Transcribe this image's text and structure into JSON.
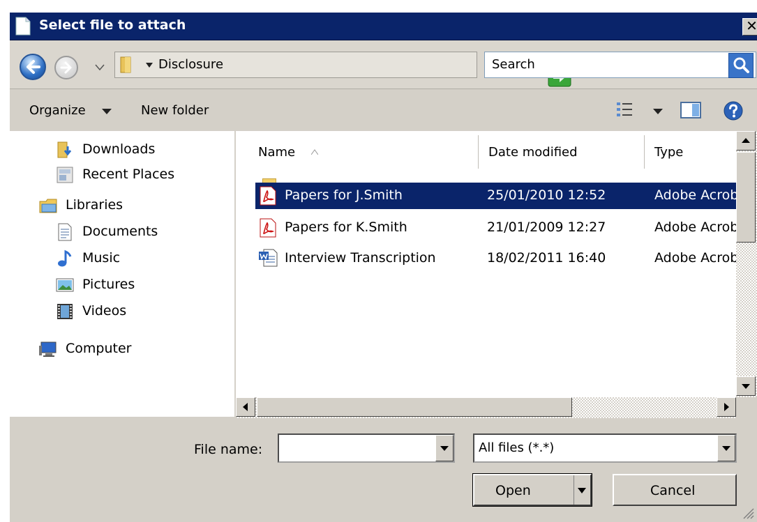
{
  "window": {
    "title": "Select file to attach",
    "close_glyph": "✕"
  },
  "address": {
    "current_folder": "Disclosure",
    "search_placeholder": "Search"
  },
  "toolbar": {
    "organize_label": "Organize",
    "new_folder_label": "New folder"
  },
  "nav_pane": {
    "items": [
      {
        "label": "Downloads",
        "icon": "downloads-folder-icon"
      },
      {
        "label": "Recent Places",
        "icon": "recent-places-icon"
      },
      {
        "label": "Libraries",
        "icon": "libraries-icon"
      },
      {
        "label": "Documents",
        "icon": "documents-icon"
      },
      {
        "label": "Music",
        "icon": "music-icon"
      },
      {
        "label": "Pictures",
        "icon": "pictures-icon"
      },
      {
        "label": "Videos",
        "icon": "videos-icon"
      },
      {
        "label": "Computer",
        "icon": "computer-icon"
      }
    ]
  },
  "file_list": {
    "columns": [
      "Name",
      "Date modified",
      "Type"
    ],
    "rows": [
      {
        "name": "Papers for J.Smith",
        "date": "25/01/2010 12:52",
        "type": "Adobe Acrobat Document",
        "icon": "pdf-icon",
        "selected": true
      },
      {
        "name": "Papers for K.Smith",
        "date": "21/01/2009 12:27",
        "type": "Adobe Acrobat Document",
        "icon": "pdf-icon",
        "selected": false
      },
      {
        "name": "Interview Transcription",
        "date": "18/02/2011 16:40",
        "type": "Adobe Acrobat Document",
        "icon": "word-doc-icon",
        "selected": false
      }
    ]
  },
  "bottom": {
    "file_name_label": "File name:",
    "file_name_value": "",
    "filter_value": "All files (*.*)",
    "open_label": "Open",
    "cancel_label": "Cancel"
  },
  "colors": {
    "title_bar": "#0a246a",
    "selection": "#0a246a",
    "face": "#d4d0c8"
  }
}
